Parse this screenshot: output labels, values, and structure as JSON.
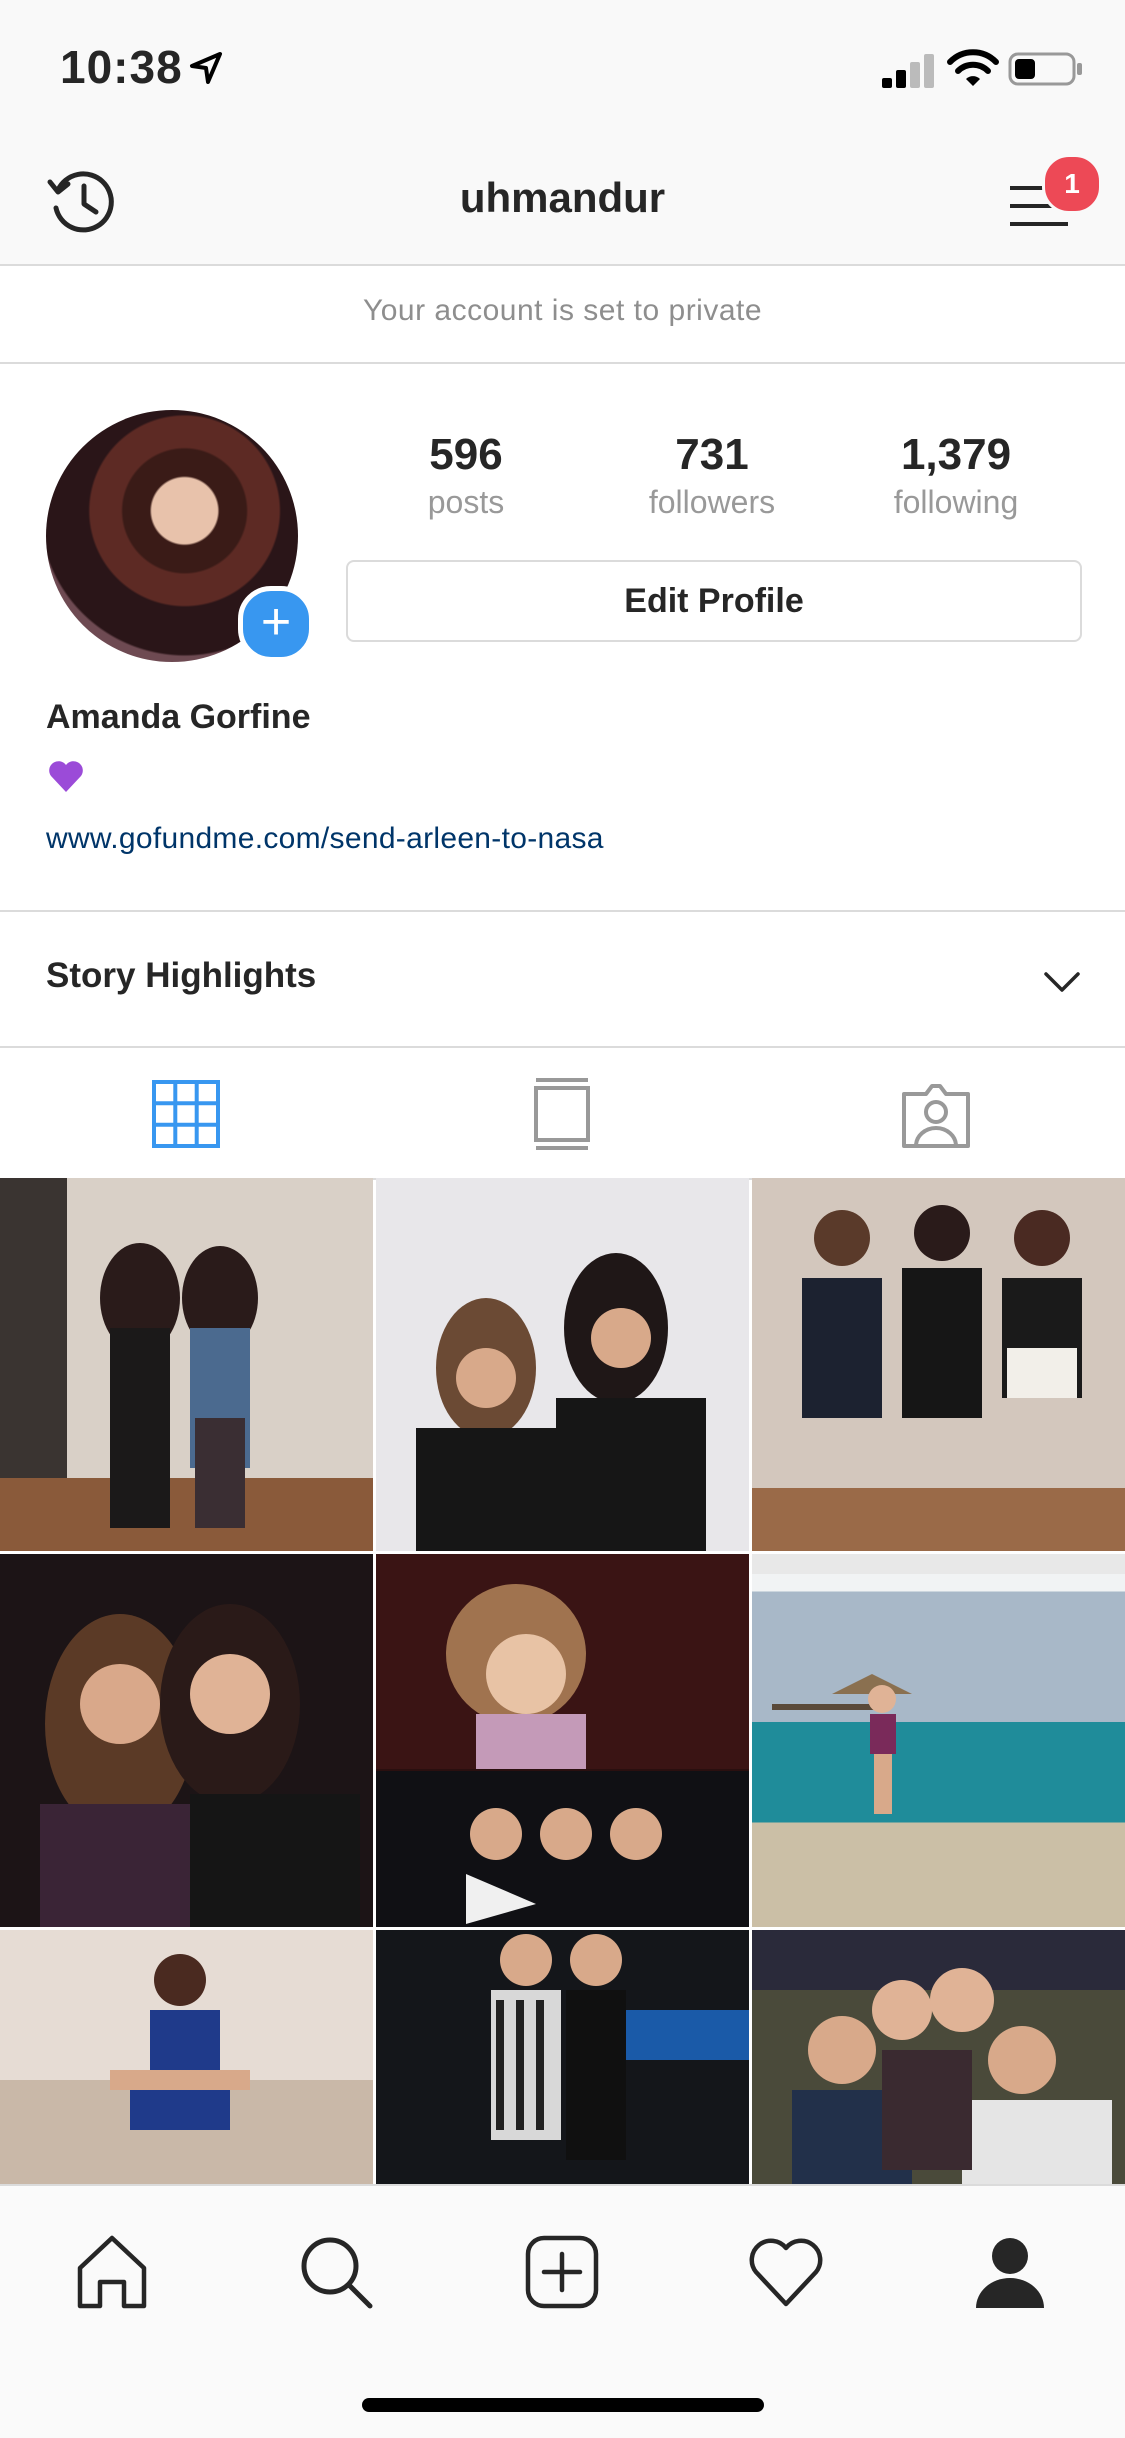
{
  "status_bar": {
    "time": "10:38"
  },
  "header": {
    "username": "uhmandur",
    "notification_count": "1"
  },
  "privacy_notice": "Your account is set to private",
  "profile": {
    "posts_count": "596",
    "posts_label": "posts",
    "followers_count": "731",
    "followers_label": "followers",
    "following_count": "1,379",
    "following_label": "following",
    "edit_button": "Edit Profile",
    "full_name": "Amanda Gorfine",
    "bio_emoji": "purple-heart",
    "website": "www.gofundme.com/send-arleen-to-nasa"
  },
  "story_highlights": {
    "title": "Story Highlights"
  },
  "view_tabs": [
    "grid-view-icon",
    "feed-view-icon",
    "tagged-photos-icon"
  ],
  "grid_photos": 9,
  "tab_bar": [
    "home-icon",
    "search-icon",
    "new-post-icon",
    "activity-heart-icon",
    "profile-icon"
  ],
  "colors": {
    "accent": "#3897f0",
    "badge": "#ed4956",
    "link": "#003569"
  }
}
